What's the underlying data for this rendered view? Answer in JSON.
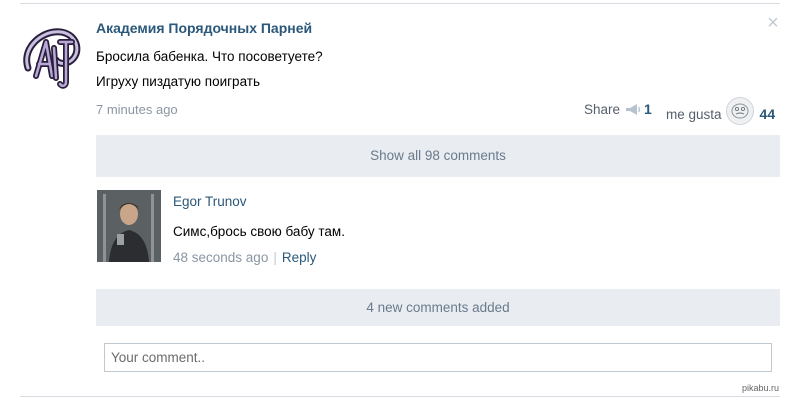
{
  "post": {
    "author": "Академия Порядочных Парней",
    "line1": "Бросила бабенка. Что посоветуете?",
    "line2": "Игруху пиздатую поиграть",
    "time": "7 minutes ago",
    "share_label": "Share",
    "share_count": "1",
    "like_label": "me gusta",
    "like_count": "44",
    "close_icon": "close-icon",
    "avatar_icon": "group-logo"
  },
  "show_all_label": "Show all 98 comments",
  "comment": {
    "author": "Egor Trunov",
    "text": "Симс,брось свою бабу там.",
    "time": "48 seconds ago",
    "separator": "|",
    "reply": "Reply"
  },
  "new_comments_label": "4 new comments added",
  "input": {
    "placeholder": "Your comment.."
  },
  "watermark": "pikabu.ru",
  "colors": {
    "link": "#2b587a",
    "muted": "#8a96a3",
    "bar_bg": "#e9ecf0"
  }
}
